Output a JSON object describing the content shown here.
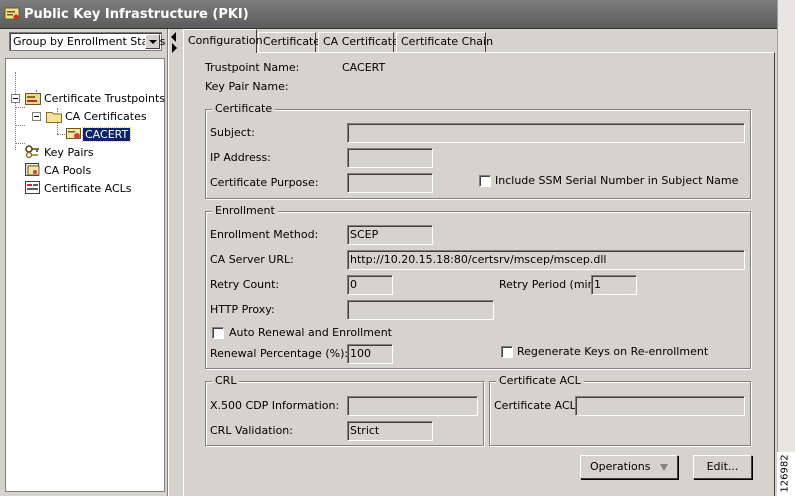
{
  "window": {
    "title": "Public Key Infrastructure (PKI)"
  },
  "left": {
    "group_select": "Group by Enrollment Status",
    "tree": [
      {
        "label": "Certificate Trustpoints",
        "icon": "trustpoints-icon"
      },
      {
        "label": "CA Certificates",
        "icon": "folder-icon"
      },
      {
        "label": "CACERT",
        "icon": "certificate-icon",
        "selected": true
      },
      {
        "label": "Key Pairs",
        "icon": "key-pairs-icon"
      },
      {
        "label": "CA Pools",
        "icon": "ca-pools-icon"
      },
      {
        "label": "Certificate ACLs",
        "icon": "acl-icon"
      }
    ]
  },
  "tabs": [
    "Configuration",
    "Certificate",
    "CA Certificate",
    "Certificate Chain"
  ],
  "config": {
    "trustpoint_name_label": "Trustpoint Name:",
    "trustpoint_name_value": "CACERT",
    "key_pair_name_label": "Key Pair Name:",
    "certificate": {
      "title": "Certificate",
      "subject_label": "Subject:",
      "subject_value": "",
      "ip_label": "IP Address:",
      "ip_value": "",
      "purpose_label": "Certificate Purpose:",
      "purpose_value": "",
      "ssm_label": "Include SSM Serial Number in Subject Name"
    },
    "enrollment": {
      "title": "Enrollment",
      "method_label": "Enrollment Method:",
      "method_value": "SCEP",
      "ca_url_label": "CA Server URL:",
      "ca_url_value": "http://10.20.15.18:80/certsrv/mscep/mscep.dll",
      "retry_count_label": "Retry Count:",
      "retry_count_value": "0",
      "retry_period_label": "Retry Period (min):",
      "retry_period_value": "1",
      "http_proxy_label": "HTTP Proxy:",
      "http_proxy_value": "",
      "auto_renew_label": "Auto Renewal and Enrollment",
      "renewal_pct_label": "Renewal Percentage (%):",
      "renewal_pct_value": "100",
      "regen_label": "Regenerate Keys on Re-enrollment"
    },
    "crl": {
      "title": "CRL",
      "cdp_label": "X.500 CDP Information:",
      "cdp_value": "",
      "validation_label": "CRL Validation:",
      "validation_value": "Strict"
    },
    "acl": {
      "title": "Certificate ACL",
      "label": "Certificate ACL:",
      "value": ""
    }
  },
  "buttons": {
    "operations": "Operations",
    "edit": "Edit..."
  },
  "figure_number": "126982"
}
